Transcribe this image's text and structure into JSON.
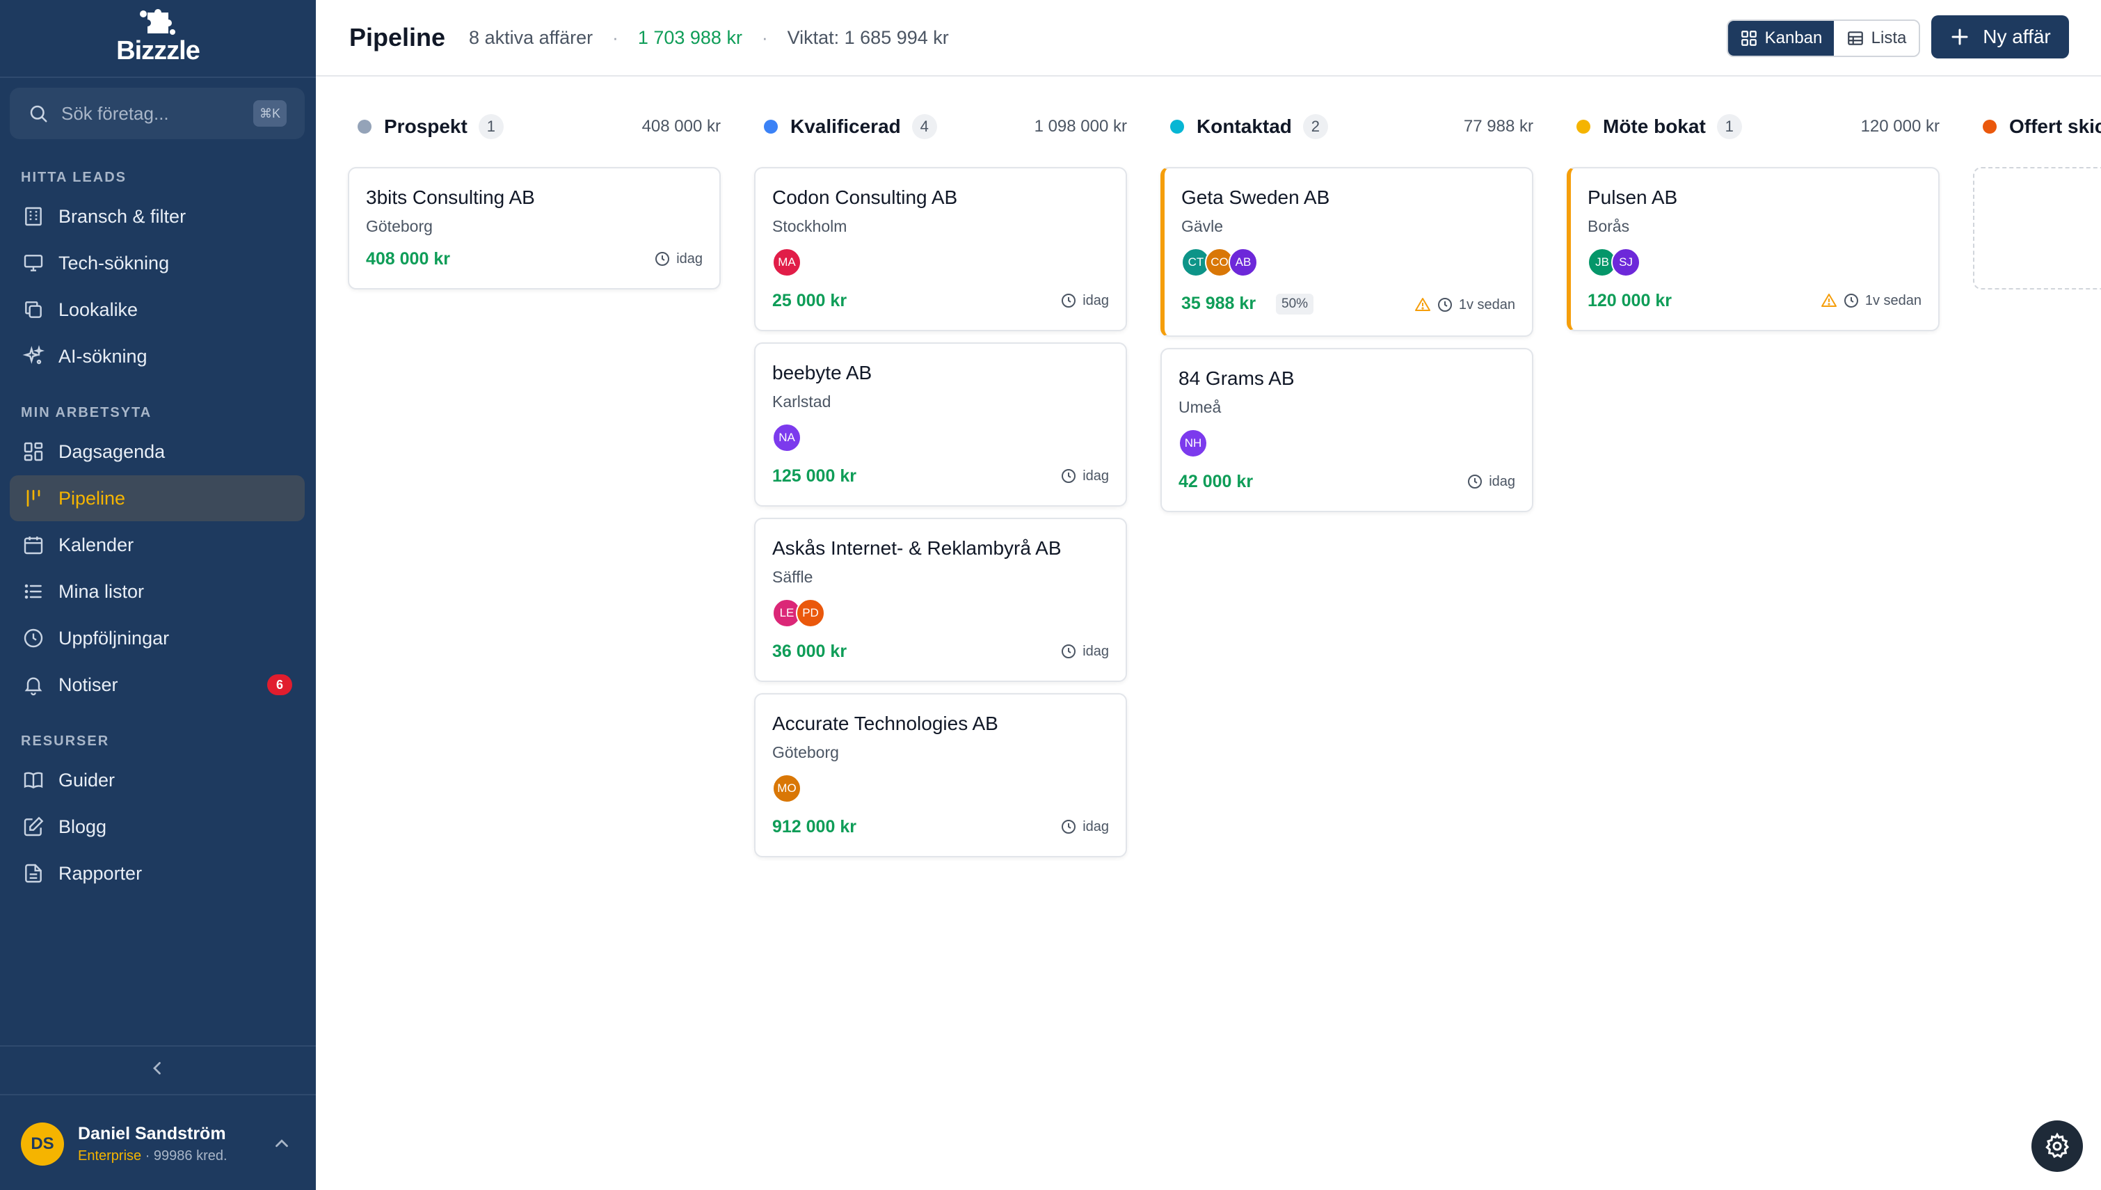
{
  "app": {
    "logo_text": "Bizzzle"
  },
  "sidebar": {
    "search": {
      "placeholder": "Sök företag...",
      "shortcut": "⌘K"
    },
    "sections": [
      {
        "label": "HITTA LEADS",
        "items": [
          {
            "label": "Bransch & filter",
            "icon": "building-icon"
          },
          {
            "label": "Tech-sökning",
            "icon": "monitor-icon"
          },
          {
            "label": "Lookalike",
            "icon": "copy-icon"
          },
          {
            "label": "AI-sökning",
            "icon": "sparkles-icon"
          }
        ]
      },
      {
        "label": "MIN ARBETSYTA",
        "items": [
          {
            "label": "Dagsagenda",
            "icon": "dashboard-icon"
          },
          {
            "label": "Pipeline",
            "icon": "pipeline-icon",
            "active": true
          },
          {
            "label": "Kalender",
            "icon": "calendar-icon"
          },
          {
            "label": "Mina listor",
            "icon": "list-icon"
          },
          {
            "label": "Uppföljningar",
            "icon": "clock-icon"
          },
          {
            "label": "Notiser",
            "icon": "bell-icon",
            "badge": "6"
          }
        ]
      },
      {
        "label": "RESURSER",
        "items": [
          {
            "label": "Guider",
            "icon": "book-icon"
          },
          {
            "label": "Blogg",
            "icon": "edit-icon"
          },
          {
            "label": "Rapporter",
            "icon": "file-icon"
          }
        ]
      }
    ],
    "user": {
      "initials": "DS",
      "name": "Daniel Sandström",
      "plan": "Enterprise",
      "credits": "· 99986 kred."
    }
  },
  "header": {
    "title": "Pipeline",
    "active_deals": "8 aktiva affärer",
    "separator": "·",
    "total": "1 703 988 kr",
    "weighted": "Viktat: 1 685 994 kr",
    "view_kanban": "Kanban",
    "view_lista": "Lista",
    "new_deal": "Ny affär"
  },
  "colors": {
    "sidebar_bg": "#1e3a5f",
    "accent_yellow": "#f5b400",
    "amount_green": "#0f9d58",
    "warning_orange": "#f59e0b"
  },
  "columns": [
    {
      "title": "Prospekt",
      "count": "1",
      "total": "408 000 kr",
      "color": "#94a3b8",
      "cards": [
        {
          "name": "3bits Consulting AB",
          "city": "Göteborg",
          "avatars": [],
          "amount": "408 000 kr",
          "time": "idag",
          "warning": false
        }
      ]
    },
    {
      "title": "Kvalificerad",
      "count": "4",
      "total": "1 098 000 kr",
      "color": "#3b82f6",
      "cards": [
        {
          "name": "Codon Consulting AB",
          "city": "Stockholm",
          "avatars": [
            {
              "initials": "MA",
              "color": "#e11d48"
            }
          ],
          "amount": "25 000 kr",
          "time": "idag",
          "warning": false
        },
        {
          "name": "beebyte AB",
          "city": "Karlstad",
          "avatars": [
            {
              "initials": "NA",
              "color": "#7c3aed"
            }
          ],
          "amount": "125 000 kr",
          "time": "idag",
          "warning": false
        },
        {
          "name": "Askås Internet- & Reklambyrå AB",
          "city": "Säffle",
          "avatars": [
            {
              "initials": "LE",
              "color": "#db2777"
            },
            {
              "initials": "PD",
              "color": "#ea580c"
            }
          ],
          "amount": "36 000 kr",
          "time": "idag",
          "warning": false
        },
        {
          "name": "Accurate Technologies AB",
          "city": "Göteborg",
          "avatars": [
            {
              "initials": "MO",
              "color": "#d97706"
            }
          ],
          "amount": "912 000 kr",
          "time": "idag",
          "warning": false
        }
      ]
    },
    {
      "title": "Kontaktad",
      "count": "2",
      "total": "77 988 kr",
      "color": "#06b6d4",
      "cards": [
        {
          "name": "Geta Sweden AB",
          "city": "Gävle",
          "avatars": [
            {
              "initials": "CT",
              "color": "#0d9488"
            },
            {
              "initials": "CO",
              "color": "#d97706"
            },
            {
              "initials": "AB",
              "color": "#6d28d9"
            }
          ],
          "amount": "35 988 kr",
          "percent": "50%",
          "time": "1v sedan",
          "warning": true
        },
        {
          "name": "84 Grams AB",
          "city": "Umeå",
          "avatars": [
            {
              "initials": "NH",
              "color": "#7c3aed"
            }
          ],
          "amount": "42 000 kr",
          "time": "idag",
          "warning": false
        }
      ]
    },
    {
      "title": "Möte bokat",
      "count": "1",
      "total": "120 000 kr",
      "color": "#f5b400",
      "cards": [
        {
          "name": "Pulsen AB",
          "city": "Borås",
          "avatars": [
            {
              "initials": "JB",
              "color": "#059669"
            },
            {
              "initials": "SJ",
              "color": "#6d28d9"
            }
          ],
          "amount": "120 000 kr",
          "time": "1v sedan",
          "warning": true
        }
      ]
    },
    {
      "title": "Offert skic",
      "count": "",
      "total": "",
      "color": "#ea580c",
      "cards": []
    }
  ]
}
